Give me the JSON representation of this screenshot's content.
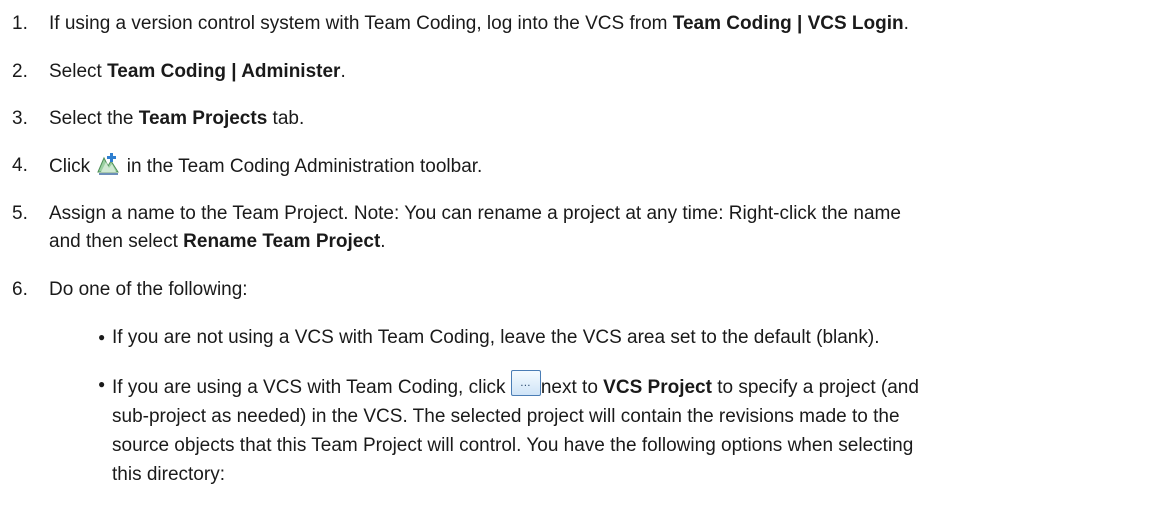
{
  "steps": [
    {
      "number": "1.",
      "pre": "If using a version control system with Team Coding, log into the VCS from ",
      "bold": "Team Coding | VCS Login",
      "post": "."
    },
    {
      "number": "2.",
      "pre": "Select ",
      "bold": "Team Coding | Administer",
      "post": "."
    },
    {
      "number": "3.",
      "pre": "Select the ",
      "bold": "Team Projects",
      "post": " tab."
    },
    {
      "number": "4.",
      "pre": "Click ",
      "icon": "add-team-project-icon",
      "post": " in the Team Coding Administration toolbar."
    },
    {
      "number": "5.",
      "line1": "Assign a name to the Team Project. Note: You can rename a project at any time: Right-click the name",
      "line2_pre": "and then select ",
      "bold": "Rename Team Project",
      "post": "."
    },
    {
      "number": "6.",
      "text": "Do one of the following:"
    }
  ],
  "bullets": [
    {
      "text": "If you are not using a VCS with Team Coding, leave the VCS area set to the default (blank)."
    },
    {
      "pre": "If you are using a VCS with Team Coding, click ",
      "button_icon": "ellipsis-button-icon",
      "button_label": "…",
      "mid": "next to ",
      "bold": "VCS Project",
      "post": " to specify a project (and",
      "lines": [
        "sub-project as needed) in the VCS. The selected project will contain the revisions made to the",
        "source objects that this Team Project will control. You have the following options when selecting",
        "this directory:"
      ]
    }
  ]
}
